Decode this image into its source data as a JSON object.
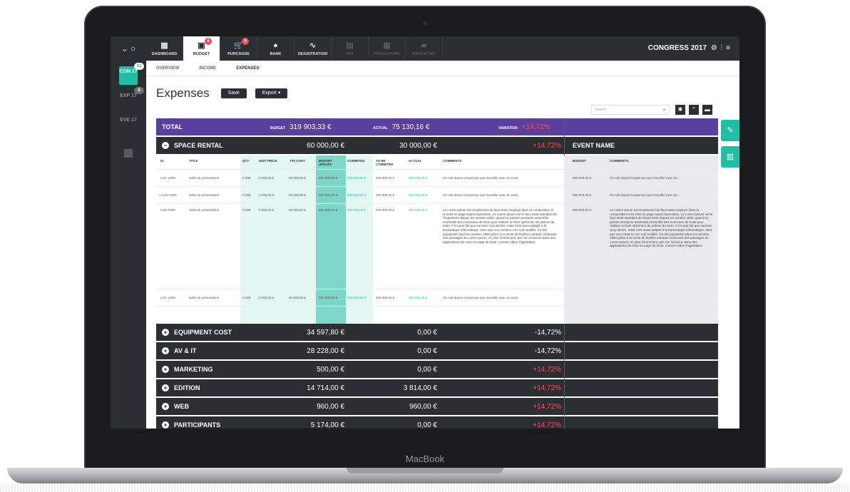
{
  "device": {
    "label": "MacBook"
  },
  "sidebar": {
    "top": "⌄ ○",
    "projects": [
      {
        "label": "CON 17",
        "badge": "12",
        "active": true
      },
      {
        "label": "EXP 17",
        "badge": "6",
        "active": false
      },
      {
        "label": "EVE 17",
        "badge": "",
        "active": false
      }
    ]
  },
  "nav": [
    {
      "label": "DASHBOARD",
      "icon": "▦",
      "badge": ""
    },
    {
      "label": "BUDGET",
      "icon": "▣",
      "badge": "8"
    },
    {
      "label": "PURCHASE",
      "icon": "🛒",
      "badge": "5"
    },
    {
      "label": "BANK",
      "icon": "●",
      "badge": ""
    },
    {
      "label": "REGISTRATION",
      "icon": "∿",
      "badge": ""
    },
    {
      "label": "BIO",
      "icon": "▤",
      "badge": ""
    },
    {
      "label": "PROGRAMME",
      "icon": "▦",
      "badge": ""
    },
    {
      "label": "MARKETING",
      "icon": "▰",
      "badge": ""
    }
  ],
  "brand": "CONGRESS 2017",
  "subnav": [
    "OVERVIEW",
    "INCOME",
    "EXPENSES"
  ],
  "page": {
    "title": "Expenses",
    "save": "Save",
    "export": "Export ▾",
    "search": "Search"
  },
  "total": {
    "label": "TOTAL",
    "budget_lbl": "BUDGET",
    "budget": "319 903,33 €",
    "actual_lbl": "ACTUAL",
    "actual": "75 130,16 €",
    "var_lbl": "VARIATION",
    "var": "+14,72%"
  },
  "space": {
    "label": "SPACE RENTAL",
    "budget": "60 000,00 €",
    "actual": "30 000,00 €",
    "var": "+14,72%",
    "event": "EVENT NAME"
  },
  "columns": [
    "ID",
    "TITLE",
    "QTY",
    "UNIT PRICE",
    "FIX COST",
    "BUDGET UPDATE",
    "COMMITED",
    "TO BE COMMITED",
    "ACTUAL",
    "COMMENTS",
    "BUDGET",
    "COMMENTS"
  ],
  "rows": [
    {
      "id": "LOC-1000",
      "title": "Salle de présentation",
      "qty": "0 000",
      "unit": "0 000,00 €",
      "fix": "00 000,00 €",
      "upd": "000 000,00 €",
      "com": "000 000,00 €",
      "tbc": "000 000,00 €",
      "act": "000 000,00 €",
      "cmt": "On sait depuis longtemps que travailler avec du texte",
      "eb": "000 000,00 €",
      "ec": "On sait depuis longtemps que travailler avec du..."
    },
    {
      "id": "≡ LOC-1000",
      "title": "Salle de présentation",
      "qty": "0 000",
      "unit": "0 000,00 €",
      "fix": "00 000,00 €",
      "upd": "000 000,00 €",
      "com": "000 000,00 €",
      "tbc": "000 000,00 €",
      "act": "000 000,00 €",
      "cmt": "On sait depuis longtemps que travailler avec du texte",
      "eb": "000 000,00 €",
      "ec": "On sait depuis longtemps que travailler avec du..."
    },
    {
      "id": "LOC-1000",
      "title": "Salle de présentation",
      "qty": "0 000",
      "unit": "0 000,00 €",
      "fix": "00 000,00 €",
      "upd": "000 000,00 €",
      "com": "000 000,00 €",
      "tbc": "000 000,00 €",
      "act": "000 000,00 €",
      "cmt": "Le Lorem Ipsum est simplement du faux texte employé dans la composition et la mise en page avant impression. Le Lorem Ipsum est le faux texte standard de l'imprimerie depuis les années 1500, quand un peintre anonyme assembla ensemble des morceaux de texte pour réaliser un livre spécimen de polices de texte. Il n'a pas fait que survivre cinq siècles, mais s'est aussi adapté à la bureautique informatique, sans que son contenu n'en soit modifié. Il a été popularisé dans les années 1960 grâce à la vente de feuilles Letraset contenant des passages du Lorem Ipsum, et, plus récemment, par son inclusion dans des applications de mise en page de texte, comme Aldus PageMaker.",
      "eb": "000 000,00 €",
      "ec": "Le Lorem Ipsum est simplement du faux texte employé dans la composition et la mise en page avant impression. Le Lorem Ipsum est le faux texte standard de l'imprimerie depuis les années 1500, quand un peintre anonyme assembla ensemble des morceaux de texte pour réaliser un livre spécimen de polices de texte. Il n'a pas fait que survivre cinq siècles, mais s'est aussi adapté à la bureautique informatique, sans que son contenu n'en soit modifié. Il a été popularisé dans les années 1960 grâce à la vente de feuilles Letraset contenant des passages du Lorem Ipsum, et, plus récemment, par son inclusion dans des applications de mise en page de texte, comme Aldus PageMaker."
    },
    {
      "id": "LOC-1000",
      "title": "Salle de présentation",
      "qty": "0 000",
      "unit": "0 000,00 €",
      "fix": "00 000,00 €",
      "upd": "000 000,00 €",
      "com": "000 000,00 €",
      "tbc": "000 000,00 €",
      "act": "000 000,00 €",
      "cmt": "On sait depuis longtemps que travailler avec du texte",
      "eb": "",
      "ec": ""
    }
  ],
  "categories": [
    {
      "label": "EQUIPMENT COST",
      "budget": "34 597,80 €",
      "actual": "0,00 €",
      "var": "-14,72%",
      "neg": false
    },
    {
      "label": "AV & IT",
      "budget": "28 228,00 €",
      "actual": "0,00 €",
      "var": "-14,72%",
      "neg": false
    },
    {
      "label": "MARKETING",
      "budget": "500,00 €",
      "actual": "0,00 €",
      "var": "+14,72%",
      "neg": true
    },
    {
      "label": "EDITION",
      "budget": "14 714,00 €",
      "actual": "3 814,00 €",
      "var": "+14,72%",
      "neg": true
    },
    {
      "label": "WEB",
      "budget": "960,00 €",
      "actual": "960,00 €",
      "var": "+14,72%",
      "neg": true
    },
    {
      "label": "PARTICIPANTS",
      "budget": "5 174,00 €",
      "actual": "0,00 €",
      "var": "+14,72%",
      "neg": true
    }
  ],
  "colors": {
    "accent": "#1fbfa5",
    "total": "#5b3f9e",
    "dark": "#2b2e33",
    "negative": "#ff4b5a"
  }
}
